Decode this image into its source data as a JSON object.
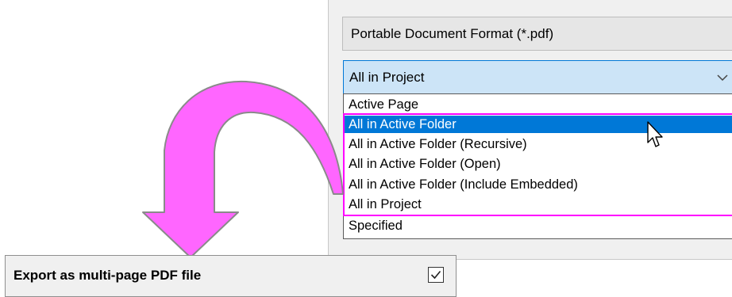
{
  "format": {
    "value": "Portable Document Format (*.pdf)"
  },
  "scope_dropdown": {
    "selected": "All in Project",
    "options": [
      "Active Page",
      "All in Active Folder",
      "All in Active Folder (Recursive)",
      "All in Active Folder (Open)",
      "All in Active Folder (Include Embedded)",
      "All in Project",
      "Specified"
    ],
    "hovered_option": "All in Active Folder"
  },
  "multi_page_option": {
    "label": "Export as multi-page PDF file",
    "checked": true
  },
  "colors": {
    "accent": "#0078d7",
    "selected_bg": "#cce4f7",
    "highlight_frame": "#ff00ff",
    "arrow": "#ff66ff"
  }
}
